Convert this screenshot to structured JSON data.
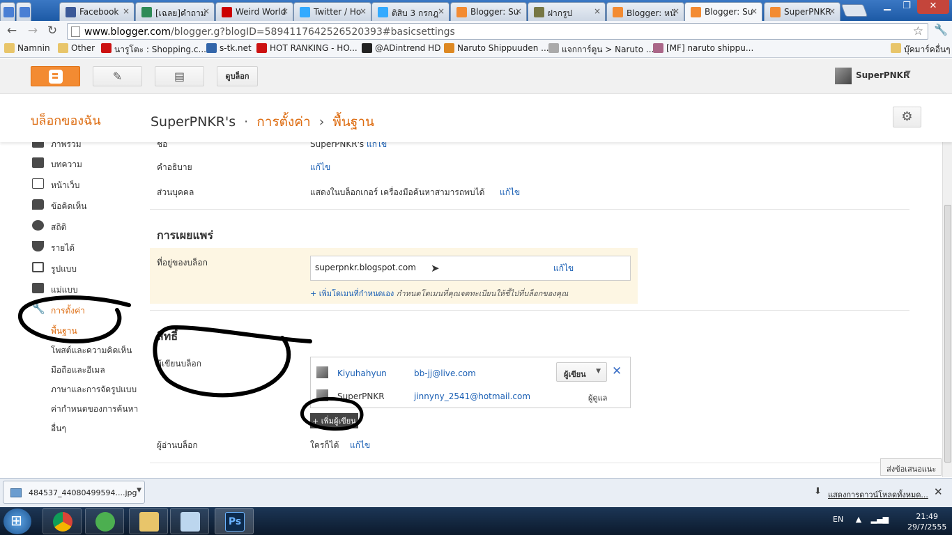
{
  "browser": {
    "tabs": [
      {
        "label": "",
        "color": "#4a7fd4"
      },
      {
        "label": "",
        "color": "#4a7fd4"
      },
      {
        "label": "Facebook",
        "color": "#3b5998"
      },
      {
        "label": "[เฉลย]คำถาม",
        "color": "#2e8b57"
      },
      {
        "label": "Weird World",
        "color": "#cc0000"
      },
      {
        "label": "Twitter / Ho",
        "color": "#33aaff"
      },
      {
        "label": "ติสิบ 3 กรกฎ",
        "color": "#33aaff"
      },
      {
        "label": "Blogger: Su",
        "color": "#f38b32"
      },
      {
        "label": "ฝากรูป",
        "color": "#777744"
      },
      {
        "label": "Blogger: หน้",
        "color": "#f38b32"
      },
      {
        "label": "Blogger: Su",
        "color": "#f38b32"
      },
      {
        "label": "SuperPNKR",
        "color": "#f38b32"
      }
    ],
    "active_tab_index": 10,
    "url_host": "www.blogger.com",
    "url_path": "/blogger.g?blogID=5894117642526520393#basicsettings",
    "bookmarks": [
      {
        "label": "Namnin",
        "color": "#e8c56a"
      },
      {
        "label": "Other",
        "color": "#e8c56a"
      },
      {
        "label": "นารูโตะ : Shopping.c...",
        "color": "#cc1111"
      },
      {
        "label": "s-tk.net",
        "color": "#3366aa"
      },
      {
        "label": "HOT RANKING - HO...",
        "color": "#cc1111"
      },
      {
        "label": "@ADintrend HD",
        "color": "#222222"
      },
      {
        "label": "Naruto Shippuuden ...",
        "color": "#dd8822"
      },
      {
        "label": "แจกการ์ตูน > Naruto ...",
        "color": "#aaaaaa"
      },
      {
        "label": "[MF] naruto shippu...",
        "color": "#aa6688"
      },
      {
        "label": "บุ๊คมาร์คอื่นๆ",
        "color": "#e8c56a"
      }
    ]
  },
  "blogger_bar": {
    "view_blog_label": "ดูบล็อก",
    "username": "SuperPNKR"
  },
  "title": {
    "my_blogs": "บล็อกของฉัน",
    "blog_name": "SuperPNKR's",
    "dot": "·",
    "settings": "การตั้งค่า",
    "arrow": "›",
    "basic": "พื้นฐาน"
  },
  "sidebar": {
    "items": [
      {
        "label": "ภาพรวม"
      },
      {
        "label": "บทความ"
      },
      {
        "label": "หน้าเว็บ"
      },
      {
        "label": "ข้อคิดเห็น"
      },
      {
        "label": "สถิติ"
      },
      {
        "label": "รายได้"
      },
      {
        "label": "รูปแบบ"
      },
      {
        "label": "แม่แบบ"
      },
      {
        "label": "การตั้งค่า"
      }
    ],
    "subitems": [
      {
        "label": "พื้นฐาน"
      },
      {
        "label": "โพสต์และความคิดเห็น"
      },
      {
        "label": "มือถือและอีเมล"
      },
      {
        "label": "ภาษาและการจัดรูปแบบ"
      },
      {
        "label": "ค่ากำหนดของการค้นหา"
      },
      {
        "label": "อื่นๆ"
      }
    ]
  },
  "basic": {
    "title_label": "ชื่อ",
    "title_value": "SuperPNKR's",
    "title_edit": "แก้ไข",
    "desc_label": "คำอธิบาย",
    "desc_edit": "แก้ไข",
    "privacy_label": "ส่วนบุคคล",
    "privacy_value": "แสดงในบล็อกเกอร์ เครื่องมือค้นหาสามารถพบได้",
    "privacy_edit": "แก้ไข"
  },
  "publishing": {
    "section_title": "การเผยแพร่",
    "address_label": "ที่อยู่ของบล็อก",
    "address_value": "superpnkr.blogspot.com",
    "address_edit": "แก้ไข",
    "add_domain": "+ เพิ่มโดเมนที่กำหนดเอง",
    "add_domain_hint": "กำหนดโดเมนที่คุณจดทะเบียนให้ชี้ไปที่บล็อกของคุณ"
  },
  "permissions": {
    "section_title": "สิทธิ์",
    "authors_label": "ผู้เขียนบล็อก",
    "authors": [
      {
        "name": "Kiyuhahyun",
        "email": "bb-jj@live.com",
        "role": "ผู้เขียน"
      },
      {
        "name": "SuperPNKR",
        "email": "jinnyny_2541@hotmail.com",
        "role": "ผู้ดูแล"
      }
    ],
    "add_author": "+ เพิ่มผู้เขียน",
    "readers_label": "ผู้อ่านบล็อก",
    "readers_value": "ใครก็ได้",
    "readers_edit": "แก้ไข"
  },
  "feedback_label": "ส่งข้อเสนอแนะ",
  "downloads": {
    "file": "484537_44080499594....jpg",
    "show_all": "แสดงการดาวน์โหลดทั้งหมด..."
  },
  "taskbar": {
    "lang": "EN",
    "time": "21:49",
    "date": "29/7/2555"
  }
}
